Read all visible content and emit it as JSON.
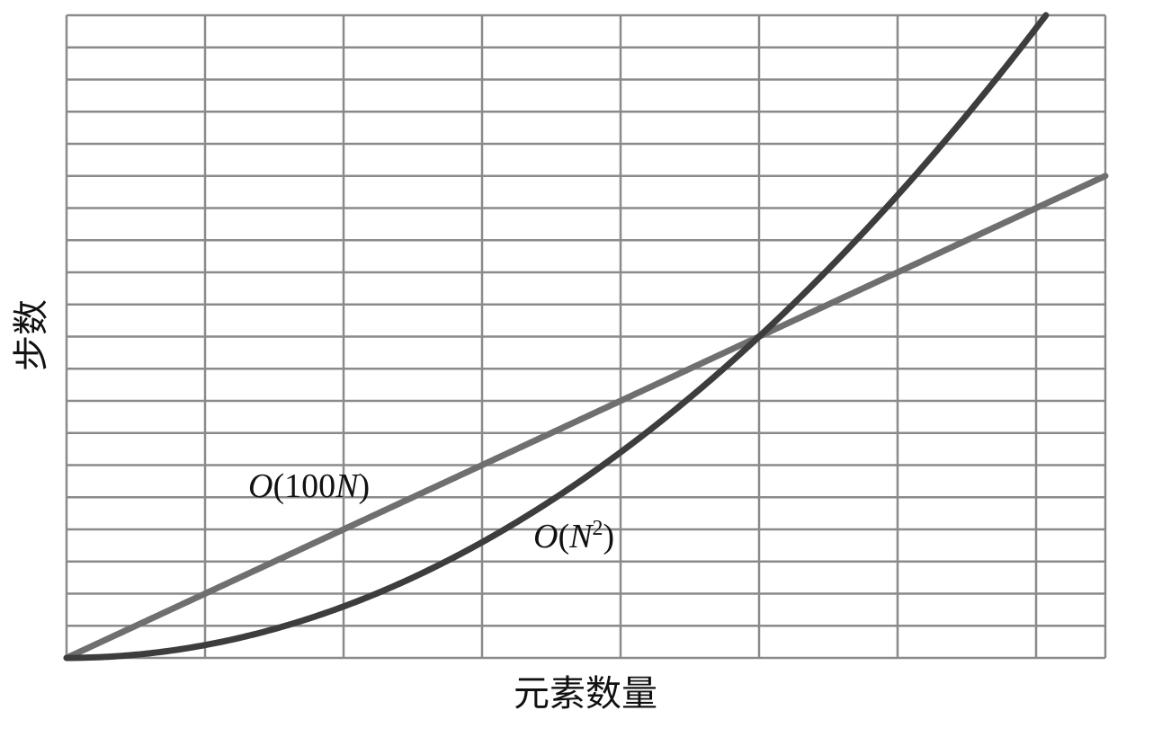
{
  "chart_data": {
    "type": "line",
    "xlabel": "元素数量",
    "ylabel": "步数",
    "xlim": [
      0,
      150
    ],
    "ylim": [
      0,
      20000
    ],
    "x_gridlines": 7.5,
    "y_gridlines": 20,
    "grid": true,
    "colors": {
      "grid": "#8a8a8a",
      "linear": "#6f6f6f",
      "quadratic": "#3d3d3d"
    },
    "series": [
      {
        "label_parts": [
          "O",
          "(100",
          "N",
          ")"
        ],
        "formula": "100*x",
        "x": [
          0,
          20,
          40,
          60,
          80,
          100,
          120,
          140,
          150
        ],
        "y": [
          0,
          2000,
          4000,
          6000,
          8000,
          10000,
          12000,
          14000,
          15000
        ]
      },
      {
        "label_parts": [
          "O",
          "(",
          "N",
          "2",
          ")"
        ],
        "formula": "x^2",
        "x": [
          0,
          20,
          40,
          60,
          80,
          100,
          120,
          140,
          141.4
        ],
        "y": [
          0,
          400,
          1600,
          3600,
          6400,
          10000,
          14400,
          19600,
          20000
        ]
      }
    ]
  }
}
